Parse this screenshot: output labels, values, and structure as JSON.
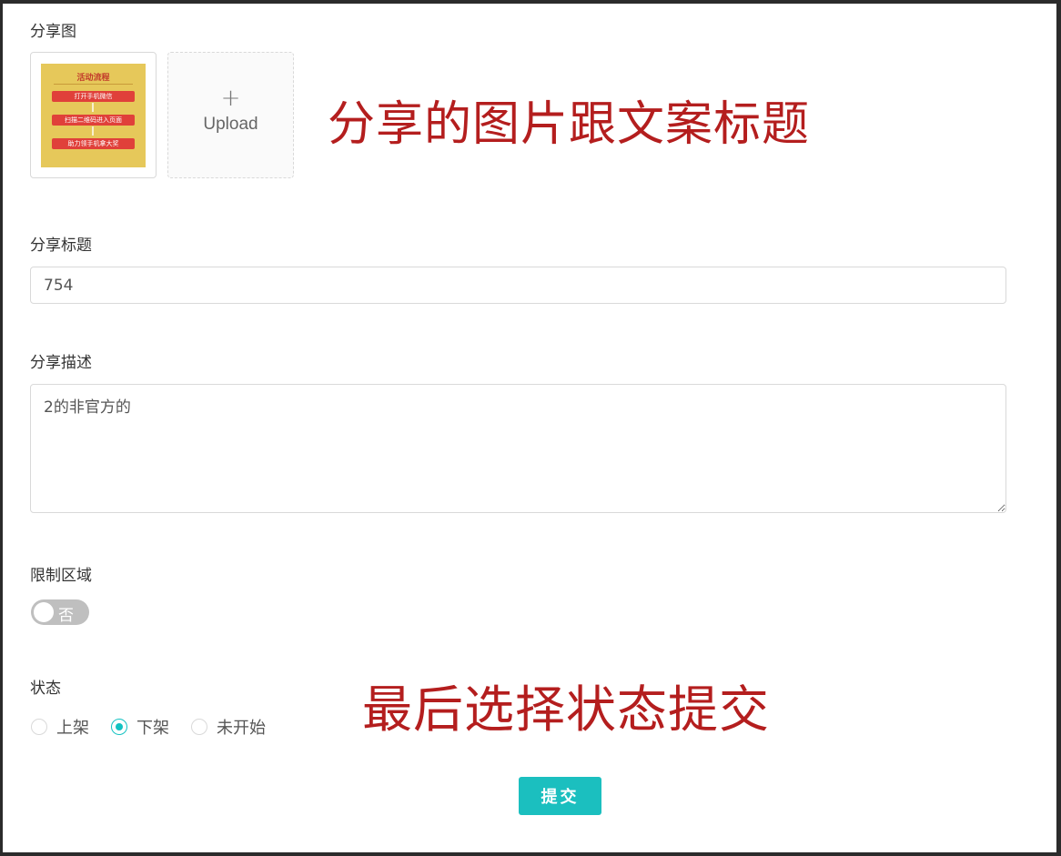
{
  "share_image": {
    "label": "分享图",
    "poster": {
      "title": "活动流程",
      "steps": [
        "打开手机微信",
        "扫描二维码进入页面",
        "助力领手机拿大奖"
      ]
    },
    "upload_plus": "+",
    "upload_label": "Upload"
  },
  "annotations": {
    "top": "分享的图片跟文案标题",
    "bottom": "最后选择状态提交",
    "color": "#b41e1e"
  },
  "share_title": {
    "label": "分享标题",
    "value": "754"
  },
  "share_desc": {
    "label": "分享描述",
    "value": "2的非官方的"
  },
  "region_limit": {
    "label": "限制区域",
    "switch_text": "否",
    "enabled": false
  },
  "status": {
    "label": "状态",
    "options": [
      "上架",
      "下架",
      "未开始"
    ],
    "selected": "下架"
  },
  "submit_label": "提交",
  "colors": {
    "accent": "#13c2c2",
    "button": "#1bbfbf",
    "border": "#d9d9d9"
  }
}
